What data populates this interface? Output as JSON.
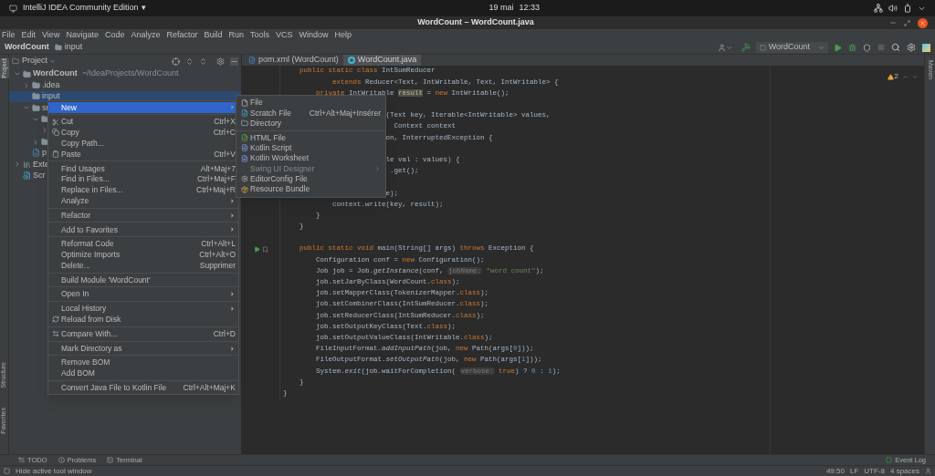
{
  "system_bar": {
    "app": "IntelliJ IDEA Community Edition",
    "app_caret": "▾",
    "date": "19 mai",
    "time": "12:33"
  },
  "window": {
    "title": "WordCount – WordCount.java"
  },
  "menu_bar": [
    "File",
    "Edit",
    "View",
    "Navigate",
    "Code",
    "Analyze",
    "Refactor",
    "Build",
    "Run",
    "Tools",
    "VCS",
    "Window",
    "Help"
  ],
  "breadcrumbs": [
    {
      "label": "WordCount",
      "kind": "project"
    },
    {
      "label": "input",
      "kind": "folder"
    }
  ],
  "run_config": {
    "label": "WordCount"
  },
  "project_panel": {
    "title": "Project",
    "tree": [
      {
        "label": "WordCount",
        "path": "~/IdeaProjects/WordCount",
        "kind": "module",
        "expanded": true,
        "selected": false,
        "children": [
          {
            "label": ".idea",
            "kind": "folder",
            "expanded": false,
            "selected": false
          },
          {
            "label": "input",
            "kind": "folder",
            "selected": true
          },
          {
            "label": "sr",
            "kind": "folder",
            "expanded": true,
            "selected": false,
            "children": [
              {
                "kind": "folder",
                "expanded": true,
                "selected": false,
                "children": [
                  {
                    "expanded": false,
                    "selected": false
                  }
                ]
              },
              {
                "kind": "folder",
                "expanded": false,
                "selected": false
              }
            ]
          },
          {
            "label": "p",
            "kind": "maven",
            "selected": false
          }
        ]
      },
      {
        "label": "Exte",
        "kind": "libraries",
        "expanded": false,
        "selected": false
      },
      {
        "label": "Scr",
        "kind": "scratches",
        "selected": false
      }
    ]
  },
  "editor_tabs": [
    {
      "label": "pom.xml (WordCount)",
      "kind": "maven",
      "selected": false
    },
    {
      "label": "WordCount.java",
      "kind": "java",
      "selected": true
    }
  ],
  "inspections": {
    "warnings": "2"
  },
  "code_lines": [
    {
      "tokens": [
        {
          "text": "public static class ",
          "kind": "kw"
        },
        {
          "text": "IntSumReducer",
          "kind": "plain"
        }
      ]
    },
    {
      "tokens": [
        {
          "text": "extends ",
          "kind": "kw"
        },
        {
          "text": "Reducer<Text, IntWritable, Text, IntWritable> {",
          "kind": "plain"
        }
      ]
    },
    {
      "tokens": [
        {
          "text": "private ",
          "kind": "kw"
        },
        {
          "text": "IntWritable ",
          "kind": "plain"
        },
        {
          "text": "result",
          "kind": "marked"
        },
        {
          "text": " = ",
          "kind": "plain"
        },
        {
          "text": "new ",
          "kind": "kw"
        },
        {
          "text": "IntWritable();",
          "kind": "plain"
        }
      ]
    },
    {
      "kind": "blank"
    },
    {
      "tokens": [
        {
          "text": "(Text key, Iterable<IntWritable> values,",
          "kind": "plain"
        }
      ]
    },
    {
      "tokens": [
        {
          "text": "Context context",
          "kind": "plain"
        }
      ]
    },
    {
      "tokens": [
        {
          "text": "on, InterruptedException {",
          "kind": "plain"
        }
      ]
    },
    {
      "kind": "blank"
    },
    {
      "tokens": [
        {
          "text": "le val : values) {",
          "kind": "plain"
        }
      ]
    },
    {
      "tokens": [
        {
          "text": ".get();",
          "kind": "plain"
        }
      ]
    },
    {
      "kind": "blank"
    },
    {
      "tokens": [
        {
          "text": "e);",
          "kind": "plain"
        }
      ]
    },
    {
      "tokens": [
        {
          "text": "context.write(key, result);",
          "kind": "plain"
        }
      ]
    },
    {
      "tokens": [
        {
          "text": "}",
          "kind": "plain"
        }
      ]
    },
    {
      "tokens": [
        {
          "text": "}",
          "kind": "plain"
        }
      ]
    },
    {
      "kind": "blank"
    },
    {
      "tokens": [
        {
          "text": "public static void ",
          "kind": "kw"
        },
        {
          "text": "main(String[] args) ",
          "kind": "plain"
        },
        {
          "text": "throws ",
          "kind": "kw"
        },
        {
          "text": "Exception {",
          "kind": "plain"
        }
      ]
    },
    {
      "tokens": [
        {
          "text": "Configuration conf = ",
          "kind": "plain"
        },
        {
          "text": "new ",
          "kind": "kw"
        },
        {
          "text": "Configuration();",
          "kind": "plain"
        }
      ]
    },
    {
      "tokens": [
        {
          "text": "Job job = Job.",
          "kind": "plain"
        },
        {
          "text": "getInstance",
          "kind": "static"
        },
        {
          "text": "(conf, ",
          "kind": "plain"
        },
        {
          "text": "jobName:",
          "kind": "hint"
        },
        {
          "text": " \"word count\"",
          "kind": "str"
        },
        {
          "text": ");",
          "kind": "plain"
        }
      ]
    },
    {
      "tokens": [
        {
          "text": "job.setJarByClass(WordCount.",
          "kind": "plain"
        },
        {
          "text": "class",
          "kind": "kw"
        },
        {
          "text": ");",
          "kind": "plain"
        }
      ]
    },
    {
      "tokens": [
        {
          "text": "job.setMapperClass(TokenizerMapper.",
          "kind": "plain"
        },
        {
          "text": "class",
          "kind": "kw"
        },
        {
          "text": ");",
          "kind": "plain"
        }
      ]
    },
    {
      "tokens": [
        {
          "text": "job.setCombinerClass(IntSumReducer.",
          "kind": "plain"
        },
        {
          "text": "class",
          "kind": "kw"
        },
        {
          "text": ");",
          "kind": "plain"
        }
      ]
    },
    {
      "tokens": [
        {
          "text": "job.setReducerClass(IntSumReducer.",
          "kind": "plain"
        },
        {
          "text": "class",
          "kind": "kw"
        },
        {
          "text": ");",
          "kind": "plain"
        }
      ]
    },
    {
      "tokens": [
        {
          "text": "job.setOutputKeyClass(Text.",
          "kind": "plain"
        },
        {
          "text": "class",
          "kind": "kw"
        },
        {
          "text": ");",
          "kind": "plain"
        }
      ]
    },
    {
      "tokens": [
        {
          "text": "job.setOutputValueClass(IntWritable.",
          "kind": "plain"
        },
        {
          "text": "class",
          "kind": "kw"
        },
        {
          "text": ");",
          "kind": "plain"
        }
      ]
    },
    {
      "tokens": [
        {
          "text": "FileInputFormat.",
          "kind": "plain"
        },
        {
          "text": "addInputPath",
          "kind": "static"
        },
        {
          "text": "(job, ",
          "kind": "plain"
        },
        {
          "text": "new ",
          "kind": "kw"
        },
        {
          "text": "Path(args[",
          "kind": "plain"
        },
        {
          "text": "0",
          "kind": "num"
        },
        {
          "text": "]));",
          "kind": "plain"
        }
      ]
    },
    {
      "tokens": [
        {
          "text": "FileOutputFormat.",
          "kind": "plain"
        },
        {
          "text": "setOutputPath",
          "kind": "static"
        },
        {
          "text": "(job, ",
          "kind": "plain"
        },
        {
          "text": "new ",
          "kind": "kw"
        },
        {
          "text": "Path(args[",
          "kind": "plain"
        },
        {
          "text": "1",
          "kind": "num"
        },
        {
          "text": "]));",
          "kind": "plain"
        }
      ]
    },
    {
      "tokens": [
        {
          "text": "System.",
          "kind": "plain"
        },
        {
          "text": "exit",
          "kind": "static"
        },
        {
          "text": "(job.waitForCompletion( ",
          "kind": "plain"
        },
        {
          "text": "verbose:",
          "kind": "hint"
        },
        {
          "text": " true",
          "kind": "kw"
        },
        {
          "text": ") ? ",
          "kind": "plain"
        },
        {
          "text": "0",
          "kind": "num"
        },
        {
          "text": " : ",
          "kind": "plain"
        },
        {
          "text": "1",
          "kind": "num"
        },
        {
          "text": ");",
          "kind": "plain"
        }
      ]
    },
    {
      "tokens": [
        {
          "text": "}",
          "kind": "plain"
        }
      ]
    },
    {
      "tokens": [
        {
          "text": "}",
          "kind": "plain"
        }
      ]
    }
  ],
  "context_menu": {
    "groups": [
      [
        {
          "label": "New",
          "submenu": true,
          "selected": true
        }
      ],
      [
        {
          "label": "Cut",
          "shortcut": "Ctrl+X",
          "submenu": false,
          "selected": false
        },
        {
          "label": "Copy",
          "shortcut": "Ctrl+C",
          "submenu": false,
          "selected": false
        },
        {
          "label": "Copy Path...",
          "submenu": false,
          "selected": false
        },
        {
          "label": "Paste",
          "shortcut": "Ctrl+V",
          "submenu": false,
          "selected": false
        }
      ],
      [
        {
          "label": "Find Usages",
          "shortcut": "Alt+Maj+7",
          "submenu": false,
          "selected": false
        },
        {
          "label": "Find in Files...",
          "shortcut": "Ctrl+Maj+F",
          "submenu": false,
          "selected": false
        },
        {
          "label": "Replace in Files...",
          "shortcut": "Ctrl+Maj+R",
          "submenu": false,
          "selected": false
        },
        {
          "label": "Analyze",
          "submenu": true,
          "selected": false
        }
      ],
      [
        {
          "label": "Refactor",
          "submenu": true,
          "selected": false
        }
      ],
      [
        {
          "label": "Add to Favorites",
          "submenu": true,
          "selected": false
        }
      ],
      [
        {
          "label": "Reformat Code",
          "shortcut": "Ctrl+Alt+L",
          "submenu": false,
          "selected": false
        },
        {
          "label": "Optimize Imports",
          "shortcut": "Ctrl+Alt+O",
          "submenu": false,
          "selected": false
        },
        {
          "label": "Delete...",
          "shortcut": "Supprimer",
          "submenu": false,
          "selected": false
        }
      ],
      [
        {
          "label": "Build Module 'WordCount'",
          "submenu": false,
          "selected": false
        }
      ],
      [
        {
          "label": "Open In",
          "submenu": true,
          "selected": false
        }
      ],
      [
        {
          "label": "Local History",
          "submenu": true,
          "selected": false
        },
        {
          "label": "Reload from Disk",
          "submenu": false,
          "selected": false
        }
      ],
      [
        {
          "label": "Compare With...",
          "shortcut": "Ctrl+D",
          "submenu": false,
          "selected": false
        }
      ],
      [
        {
          "label": "Mark Directory as",
          "submenu": true,
          "selected": false
        }
      ],
      [
        {
          "label": "Remove BOM",
          "submenu": false,
          "selected": false
        },
        {
          "label": "Add BOM",
          "submenu": false,
          "selected": false
        }
      ],
      [
        {
          "label": "Convert Java File to Kotlin File",
          "shortcut": "Ctrl+Alt+Maj+K",
          "submenu": false,
          "selected": false
        }
      ]
    ]
  },
  "new_submenu": {
    "groups": [
      [
        {
          "label": "File",
          "disabled": false,
          "submenu": false
        },
        {
          "label": "Scratch File",
          "shortcut": "Ctrl+Alt+Maj+Insérer",
          "disabled": false,
          "submenu": false
        },
        {
          "label": "Directory",
          "disabled": false,
          "submenu": false
        }
      ],
      [
        {
          "label": "HTML File",
          "disabled": false,
          "submenu": false
        },
        {
          "label": "Kotlin Script",
          "disabled": false,
          "submenu": false
        },
        {
          "label": "Kotlin Worksheet",
          "disabled": false,
          "submenu": false
        },
        {
          "label": "Swing UI Designer",
          "disabled": true,
          "submenu": true
        },
        {
          "label": "EditorConfig File",
          "disabled": false,
          "submenu": false
        },
        {
          "label": "Resource Bundle",
          "disabled": false,
          "submenu": false
        }
      ]
    ]
  },
  "side_tabs": {
    "left_top": "Project",
    "left_bottom": [
      "Structure",
      "Favorites"
    ],
    "right": "Maven"
  },
  "tool_tabs": [
    "TODO",
    "Problems",
    "Terminal"
  ],
  "event_log": "Event Log",
  "status_bar": {
    "message": "Hide active tool window",
    "position": "49:50",
    "line_separator": "LF",
    "encoding": "UTF-8",
    "indent": "4 spaces"
  }
}
